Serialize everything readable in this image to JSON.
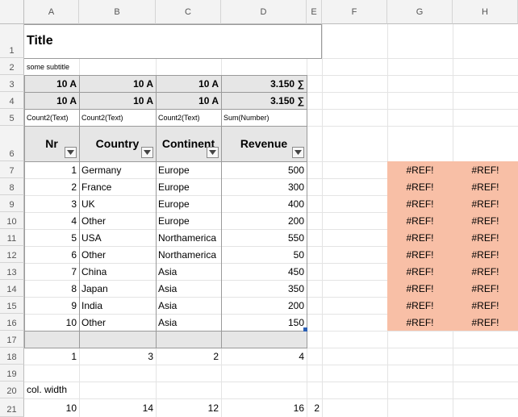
{
  "columns": [
    "A",
    "B",
    "C",
    "D",
    "E",
    "F",
    "G",
    "H"
  ],
  "rows": [
    "1",
    "2",
    "3",
    "4",
    "5",
    "6",
    "7",
    "8",
    "9",
    "10",
    "11",
    "12",
    "13",
    "14",
    "15",
    "16",
    "17",
    "18",
    "19",
    "20",
    "21"
  ],
  "title": "Title",
  "subtitle": "some subtitle",
  "summary_rows": [
    [
      "10 A",
      "10 A",
      "10 A",
      "3.150 ∑"
    ],
    [
      "10 A",
      "10 A",
      "10 A",
      "3.150 ∑"
    ]
  ],
  "aggregate_labels": [
    "Count2(Text)",
    "Count2(Text)",
    "Count2(Text)",
    "Sum(Number)"
  ],
  "table": {
    "headers": [
      "Nr",
      "Country",
      "Continent",
      "Revenue"
    ],
    "filter_icon": "dropdown-arrow-icon",
    "rows": [
      {
        "nr": "1",
        "country": "Germany",
        "continent": "Europe",
        "revenue": "500"
      },
      {
        "nr": "2",
        "country": "France",
        "continent": "Europe",
        "revenue": "300"
      },
      {
        "nr": "3",
        "country": "UK",
        "continent": "Europe",
        "revenue": "400"
      },
      {
        "nr": "4",
        "country": "Other",
        "continent": "Europe",
        "revenue": "200"
      },
      {
        "nr": "5",
        "country": "USA",
        "continent": "Northamerica",
        "revenue": "550"
      },
      {
        "nr": "6",
        "country": "Other",
        "continent": "Northamerica",
        "revenue": "50"
      },
      {
        "nr": "7",
        "country": "China",
        "continent": "Asia",
        "revenue": "450"
      },
      {
        "nr": "8",
        "country": "Japan",
        "continent": "Asia",
        "revenue": "350"
      },
      {
        "nr": "9",
        "country": "India",
        "continent": "Asia",
        "revenue": "200"
      },
      {
        "nr": "10",
        "country": "Other",
        "continent": "Asia",
        "revenue": "150"
      }
    ]
  },
  "ref_error": "#REF!",
  "ref_rows": 10,
  "row18": [
    "1",
    "3",
    "2",
    "4"
  ],
  "col_width_label": "col. width",
  "col_widths": [
    "10",
    "14",
    "12",
    "16",
    "2"
  ],
  "colors": {
    "error_fill": "#f8bfa6",
    "header_fill": "#e6e6e6",
    "grid": "#e4e4e4",
    "border": "#9a9a9a"
  }
}
